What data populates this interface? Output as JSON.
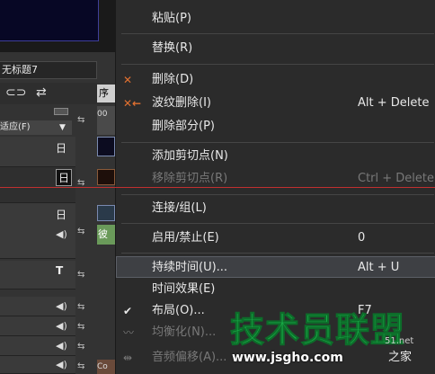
{
  "background": {
    "project_title": "无标题7",
    "mode_label": "适应(F)",
    "ruler_label": "00",
    "sequence_tab": "序",
    "track_labels": [
      "日",
      "日",
      "日",
      "T"
    ],
    "clip_label_1": "彼",
    "clip_label_2": "Co"
  },
  "menu": {
    "items": [
      {
        "label": "粘贴(P)",
        "shortcut": "",
        "disabled": false,
        "icon": ""
      },
      {
        "label": "替换(R)",
        "shortcut": "",
        "disabled": false,
        "icon": ""
      },
      {
        "label": "删除(D)",
        "shortcut": "",
        "disabled": false,
        "icon": "delete-x-icon"
      },
      {
        "label": "波纹删除(I)",
        "shortcut": "Alt + Delete",
        "disabled": false,
        "icon": "ripple-delete-icon"
      },
      {
        "label": "删除部分(P)",
        "shortcut": "",
        "disabled": false,
        "icon": ""
      },
      {
        "label": "添加剪切点(N)",
        "shortcut": "",
        "disabled": false,
        "icon": ""
      },
      {
        "label": "移除剪切点(R)",
        "shortcut": "Ctrl + Delete",
        "disabled": true,
        "icon": ""
      },
      {
        "label": "连接/组(L)",
        "shortcut": "",
        "disabled": false,
        "icon": ""
      },
      {
        "label": "启用/禁止(E)",
        "shortcut": "0",
        "disabled": false,
        "icon": ""
      },
      {
        "label": "持续时间(U)...",
        "shortcut": "Alt + U",
        "disabled": false,
        "icon": ""
      },
      {
        "label": "时间效果(E)",
        "shortcut": "",
        "disabled": false,
        "icon": ""
      },
      {
        "label": "布局(O)...",
        "shortcut": "F7",
        "disabled": false,
        "icon": "check-icon"
      },
      {
        "label": "均衡化(N)...",
        "shortcut": "",
        "disabled": true,
        "icon": "waveform-icon"
      },
      {
        "label": "音频偏移(A)...",
        "shortcut": "",
        "disabled": true,
        "icon": "audio-offset-icon"
      }
    ],
    "highlight_index": 9
  },
  "watermark": {
    "brand": "技术员联盟",
    "url": "www.jsgho.com",
    "url2": "之家",
    "url0": "51.net"
  },
  "colors": {
    "menu_bg": "#2b2b2b",
    "highlight": "#3e4044",
    "disabled_text": "#787878",
    "watermark_green": "#19b34a",
    "red_line": "#c03030"
  }
}
